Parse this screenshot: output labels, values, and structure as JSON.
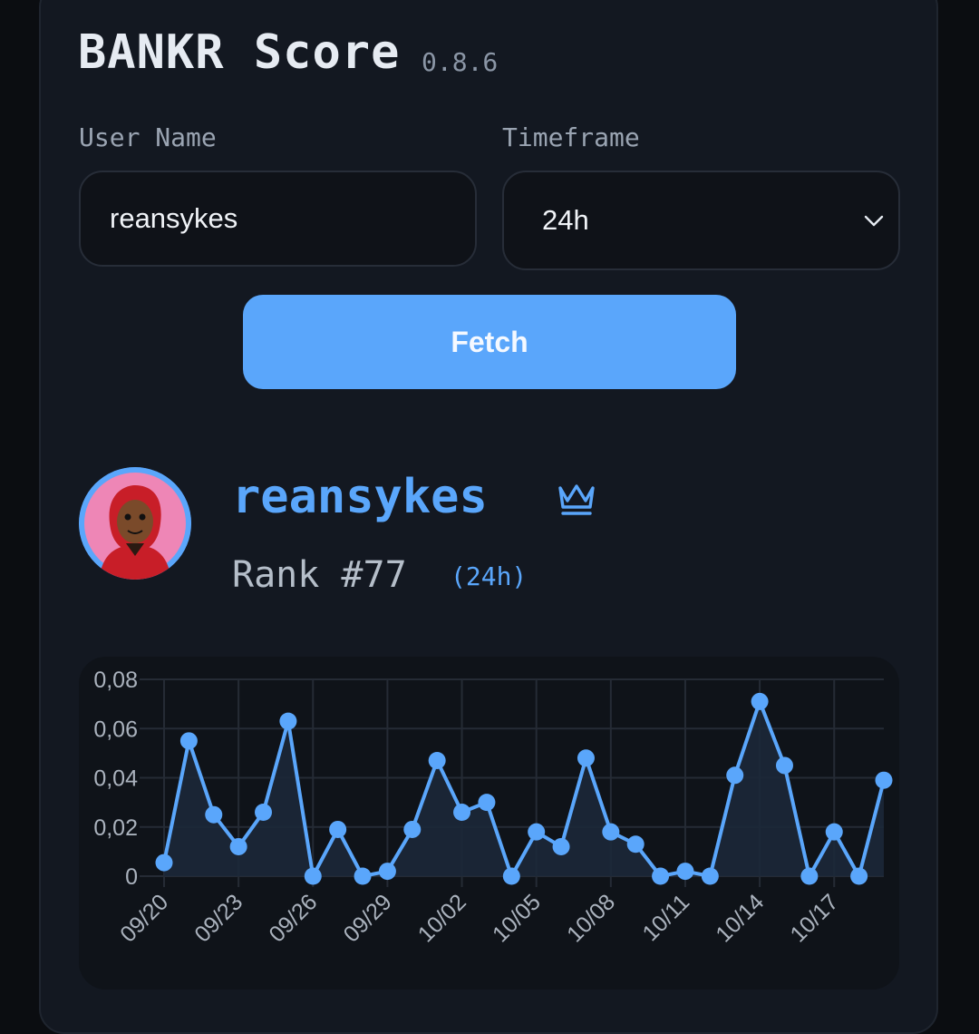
{
  "app": {
    "title": "BANKR Score",
    "version": "0.8.6"
  },
  "form": {
    "username_label": "User Name",
    "username_value": "reansykes",
    "timeframe_label": "Timeframe",
    "timeframe_value": "24h",
    "fetch_label": "Fetch"
  },
  "profile": {
    "name": "reansykes",
    "rank_label": "Rank #77",
    "timeframe_tag": "(24h)",
    "badge_icon": "crown-icon"
  },
  "colors": {
    "accent": "#5aa6fb",
    "card_bg": "#131821",
    "page_bg": "#0b0d11"
  },
  "chart_data": {
    "type": "area",
    "x": [
      "09/20",
      "09/21",
      "09/22",
      "09/23",
      "09/24",
      "09/25",
      "09/26",
      "09/27",
      "09/28",
      "09/29",
      "09/30",
      "10/01",
      "10/02",
      "10/03",
      "10/04",
      "10/05",
      "10/06",
      "10/07",
      "10/08",
      "10/09",
      "10/10",
      "10/11",
      "10/12",
      "10/13",
      "10/14",
      "10/15",
      "10/16",
      "10/17",
      "10/18",
      "10/19"
    ],
    "x_tick_labels": [
      "09/20",
      "09/23",
      "09/26",
      "09/29",
      "10/02",
      "10/05",
      "10/08",
      "10/11",
      "10/14",
      "10/17"
    ],
    "series": [
      {
        "values": [
          0.0055,
          0.055,
          0.025,
          0.012,
          0.026,
          0.063,
          0.0,
          0.019,
          0.0,
          0.002,
          0.019,
          0.047,
          0.026,
          0.03,
          0.0,
          0.018,
          0.012,
          0.048,
          0.018,
          0.013,
          0.0,
          0.002,
          0.0,
          0.041,
          0.071,
          0.045,
          0.0,
          0.018,
          0.0,
          0.039
        ]
      }
    ],
    "y_ticks": [
      "0",
      "0,02",
      "0,04",
      "0,06",
      "0,08"
    ],
    "ylim": [
      0,
      0.08
    ],
    "grid": true,
    "legend": "none"
  }
}
